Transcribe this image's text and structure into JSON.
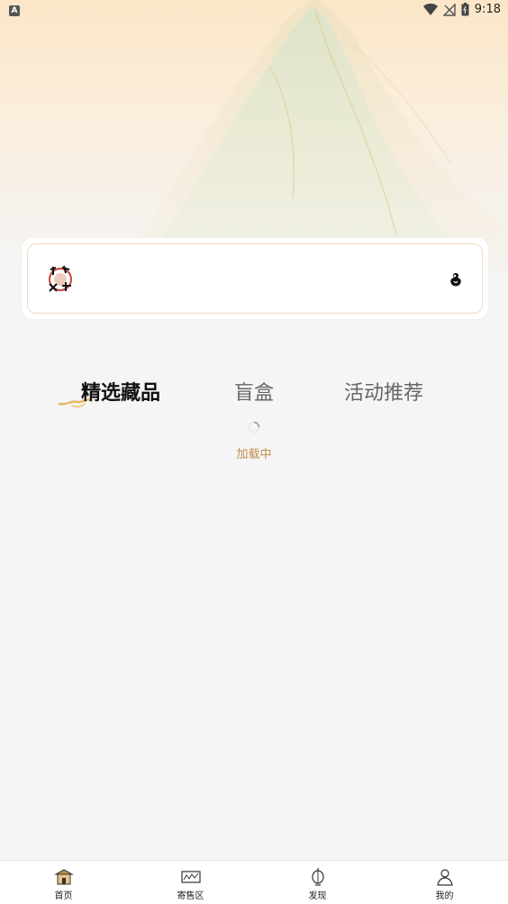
{
  "status_bar": {
    "app_badge": "A",
    "time": "9:18",
    "icons": [
      "wifi-icon",
      "signal-icon",
      "battery-icon"
    ]
  },
  "search_card": {
    "logo_icon": "brand-logo-icon",
    "right_icon": "gourd-icon"
  },
  "tabs": [
    {
      "label": "精选藏品",
      "active": true
    },
    {
      "label": "盲盒",
      "active": false
    },
    {
      "label": "活动推荐",
      "active": false
    }
  ],
  "loading": {
    "text": "加载中"
  },
  "bottom_nav": [
    {
      "label": "首页",
      "icon": "home-icon"
    },
    {
      "label": "寄售区",
      "icon": "consignment-icon"
    },
    {
      "label": "发现",
      "icon": "lantern-icon"
    },
    {
      "label": "我的",
      "icon": "profile-icon"
    }
  ],
  "colors": {
    "accent": "#c18b4a",
    "hero_top": "#fbe6c8",
    "background": "#f5f5f5"
  }
}
